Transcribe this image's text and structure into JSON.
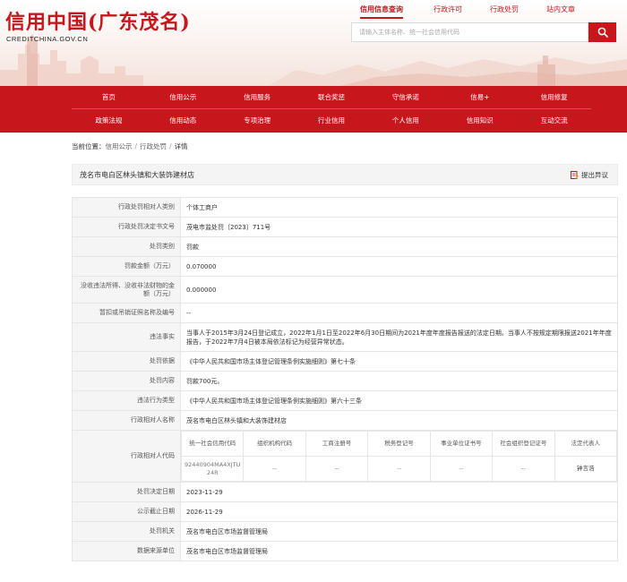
{
  "header": {
    "logo_title": "信用中国(广东茂名)",
    "logo_sub": "CREDITCHINA.GOV.CN",
    "top_links": [
      "信用信息查询",
      "行政许可",
      "行政处罚",
      "站内文章"
    ],
    "search": {
      "placeholder": "请输入主体名称、统一社会信用代码"
    },
    "accent_color": "#c8161d"
  },
  "nav": {
    "row1": [
      "首页",
      "信用公示",
      "信用服务",
      "联合奖惩",
      "守信承诺",
      "信易+",
      "信用修复"
    ],
    "row2": [
      "政策法规",
      "信用动态",
      "专项治理",
      "行业信用",
      "个人信用",
      "信用知识",
      "互动交流"
    ]
  },
  "breadcrumb": {
    "prefix": "当前位置：",
    "items": [
      "信用公示",
      "行政处罚",
      "详情"
    ]
  },
  "page": {
    "title": "茂名市电白区林头镇和大装饰建材店",
    "objection": "提出异议"
  },
  "details": [
    {
      "label": "行政处罚相对人类别",
      "value": "个体工商户"
    },
    {
      "label": "行政处罚决定书文号",
      "value": "茂电市监处罚〔2023〕711号"
    },
    {
      "label": "处罚类别",
      "value": "罚款"
    },
    {
      "label": "罚款金额（万元）",
      "value": "0.070000"
    },
    {
      "label": "没收违法所得、没收非法财物的金额（万元）",
      "value": "0.000000"
    },
    {
      "label": "暂扣或吊销证照名称及编号",
      "value": "--"
    },
    {
      "label": "违法事实",
      "value": "当事人于2015年3月24日登记成立，2022年1月1日至2022年6月30日期间为2021年度年度报告报送的法定日期。当事人不按规定期限报送2021年年度报告，于2022年7月4日被本局依法标记为经营异常状态。"
    },
    {
      "label": "处罚依据",
      "value": "《中华人民共和国市场主体登记管理条例实施细则》第七十条"
    },
    {
      "label": "处罚内容",
      "value": "罚款700元。"
    },
    {
      "label": "违法行为类型",
      "value": "《中华人民共和国市场主体登记管理条例实施细则》第六十三条"
    },
    {
      "label": "行政相对人名称",
      "value": "茂名市电白区林头镇和大装饰建材店"
    }
  ],
  "code_block": {
    "label": "行政相对人代码",
    "headers": [
      "统一社会信用代码",
      "组织机构代码",
      "工商注册号",
      "税务登记号",
      "事业单位证书号",
      "社会组织登记证号",
      "法定代表人"
    ],
    "values": [
      "92440904MA4XJTU24R",
      "--",
      "--",
      "--",
      "--",
      "--",
      "钟言浩"
    ]
  },
  "details_after": [
    {
      "label": "处罚决定日期",
      "value": "2023-11-29"
    },
    {
      "label": "公示截止日期",
      "value": "2026-11-29"
    },
    {
      "label": "处罚机关",
      "value": "茂名市电白区市场监督管理局"
    },
    {
      "label": "数据来源单位",
      "value": "茂名市电白区市场监督管理局"
    }
  ]
}
